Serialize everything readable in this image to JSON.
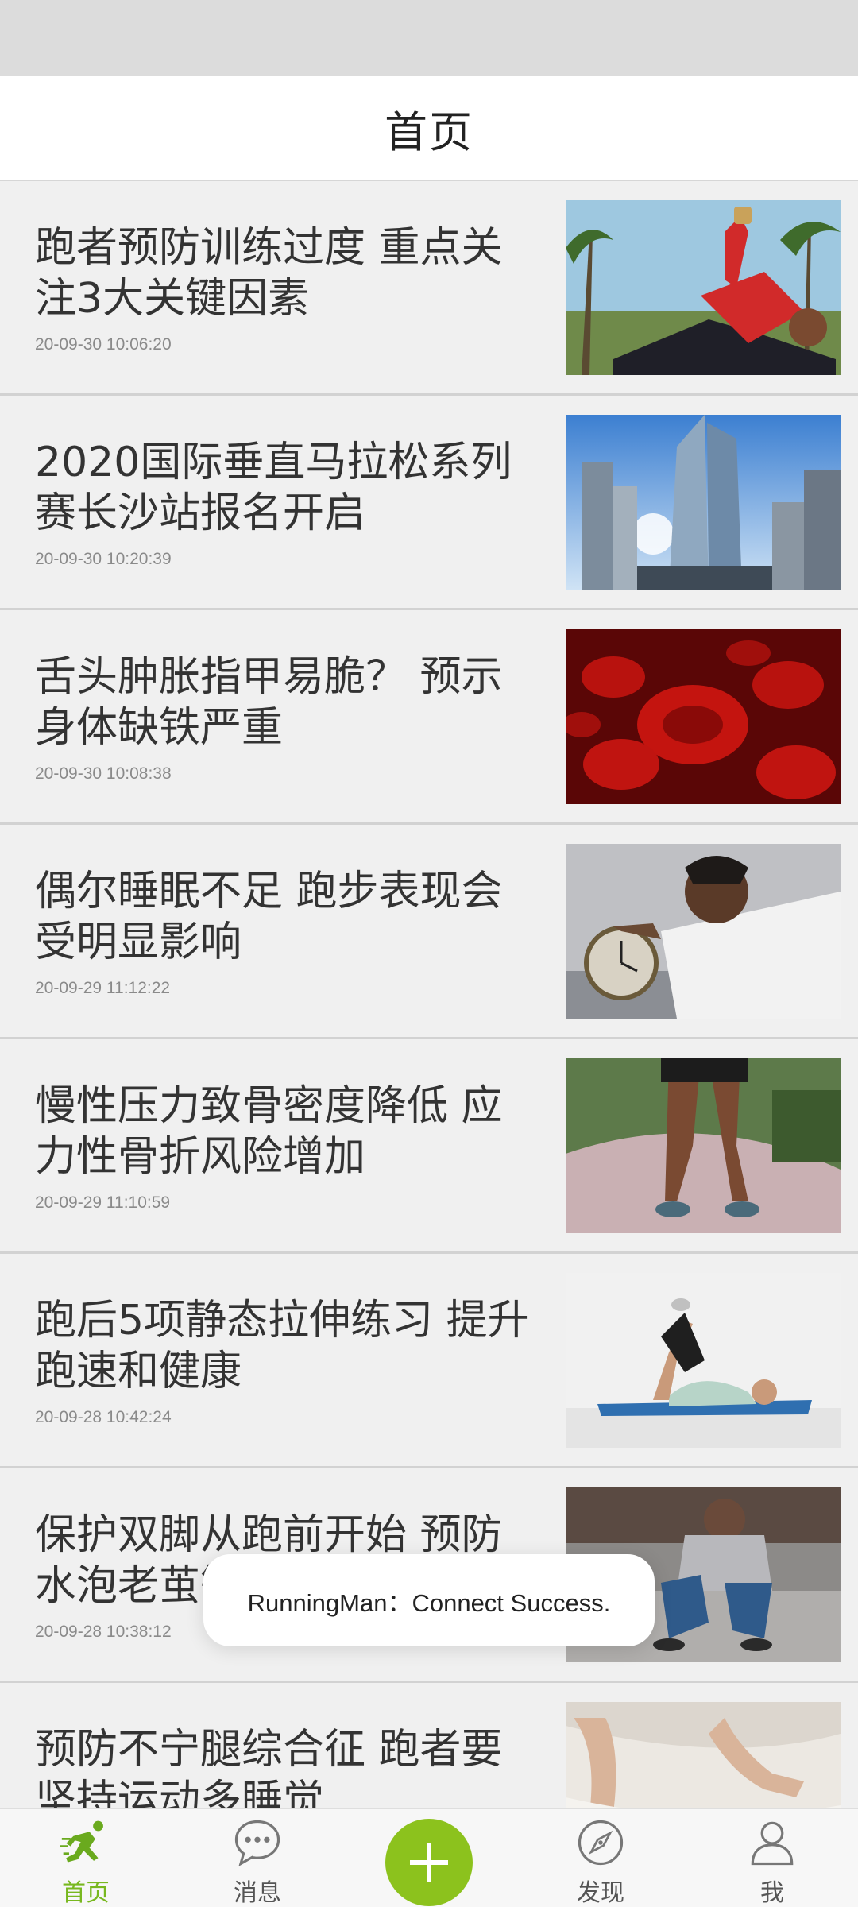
{
  "header": {
    "title": "首页"
  },
  "articles": [
    {
      "title": "跑者预防训练过度 重点关注3大关键因素",
      "time": "20-09-30 10:06:20",
      "image": "runner-resting-palm-trees"
    },
    {
      "title": "2020国际垂直马拉松系列赛长沙站报名开启",
      "time": "20-09-30 10:20:39",
      "image": "skyscraper"
    },
    {
      "title": "舌头肿胀指甲易脆？ 预示身体缺铁严重",
      "time": "20-09-30 10:08:38",
      "image": "red-blood-cells"
    },
    {
      "title": "偶尔睡眠不足 跑步表现会受明显影响",
      "time": "20-09-29 11:12:22",
      "image": "man-with-alarm-clock"
    },
    {
      "title": "慢性压力致骨密度降低 应力性骨折风险增加",
      "time": "20-09-29 11:10:59",
      "image": "runner-holding-knee"
    },
    {
      "title": "跑后5项静态拉伸练习 提升跑速和健康",
      "time": "20-09-28 10:42:24",
      "image": "woman-stretching-on-mat"
    },
    {
      "title": "保护双脚从跑前开始 预防水泡老茧等问题",
      "time": "20-09-28 10:38:12",
      "image": "runner-crouching"
    },
    {
      "title": "预防不宁腿综合征 跑者要坚持运动多睡觉",
      "time": "",
      "image": "legs-in-bed"
    }
  ],
  "toast": {
    "text": "RunningMan：Connect Success."
  },
  "tabbar": {
    "items": [
      {
        "label": "首页",
        "icon": "runner-icon",
        "active": true
      },
      {
        "label": "消息",
        "icon": "chat-bubble-icon",
        "active": false
      },
      {
        "label": "",
        "icon": "plus-icon",
        "active": false
      },
      {
        "label": "发现",
        "icon": "compass-icon",
        "active": false
      },
      {
        "label": "我",
        "icon": "user-icon",
        "active": false
      }
    ]
  },
  "colors": {
    "accent": "#8cc21d",
    "active_label": "#78b81f"
  }
}
